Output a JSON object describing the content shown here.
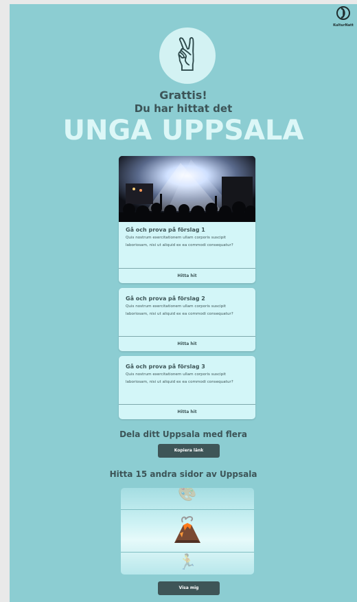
{
  "brand": {
    "name": "KulturNatt"
  },
  "hero": {
    "icon": "victory-hand-icon",
    "greeting": "Grattis!",
    "subtitle": "Du har hittat det",
    "title": "UNGA UPPSALA"
  },
  "cards": [
    {
      "title": "Gå och prova på förslag 1",
      "text": "Quis nostrum exercitationem ullam corporis suscipit laboriosam, nisi ut aliquid ex ea commodi consequatur?",
      "button": "Hitta hit",
      "has_image": true
    },
    {
      "title": "Gå och prova på förslag 2",
      "text": "Quis nostrum exercitationem ullam corporis suscipit laboriosam, nisi ut aliquid ex ea commodi consequatur?",
      "button": "Hitta hit"
    },
    {
      "title": "Gå och prova på förslag 3",
      "text": "Quis nostrum exercitationem ullam corporis suscipit laboriosam, nisi ut aliquid ex ea commodi consequatur?",
      "button": "Hitta hit"
    }
  ],
  "share": {
    "title": "Dela ditt Uppsala med flera",
    "button": "Kopiera länk"
  },
  "discover": {
    "title": "Hitta 15 andra sidor av Uppsala",
    "slides": [
      "palette-icon",
      "volcano-icon",
      "person-icon"
    ],
    "button": "Visa mig"
  },
  "colors": {
    "background": "#8ccdd2",
    "card": "#d3f6f8",
    "button": "#3e5557",
    "title": "#dcf7f7"
  }
}
